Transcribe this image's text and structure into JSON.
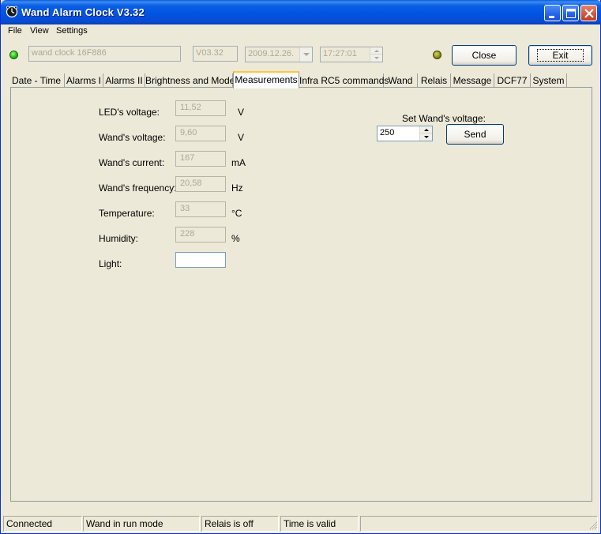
{
  "window": {
    "title": "Wand Alarm Clock V3.32"
  },
  "menu": [
    "File",
    "View",
    "Settings"
  ],
  "toolbar": {
    "device_name": "wand clock 16F886",
    "version": "V03.32",
    "date": "2009.12.26.",
    "time": "17:27:01",
    "close_label": "Close",
    "exit_label": "Exit"
  },
  "tabs": [
    "Date - Time",
    "Alarms I",
    "Alarms II",
    "Brightness and Mode",
    "Measurements",
    "Infra RC5 commands",
    "Wand",
    "Relais",
    "Message",
    "DCF77",
    "System"
  ],
  "active_tab": "Measurements",
  "measurements": [
    {
      "label": "LED's voltage:",
      "value": "11,52",
      "unit": "V"
    },
    {
      "label": "Wand's voltage:",
      "value": "9,60",
      "unit": "V"
    },
    {
      "label": "Wand's current:",
      "value": "167",
      "unit": "mA"
    },
    {
      "label": "Wand's frequency:",
      "value": "20,58",
      "unit": "Hz"
    },
    {
      "label": "Temperature:",
      "value": "33",
      "unit": "°C"
    },
    {
      "label": "Humidity:",
      "value": "228",
      "unit": "%"
    },
    {
      "label": "Light:",
      "value": "",
      "unit": ""
    }
  ],
  "set_voltage": {
    "label": "Set Wand's voltage:",
    "value": "250",
    "send_label": "Send"
  },
  "statusbar": [
    "Connected",
    "Wand in run mode",
    "Relais is off",
    "Time is valid",
    ""
  ]
}
